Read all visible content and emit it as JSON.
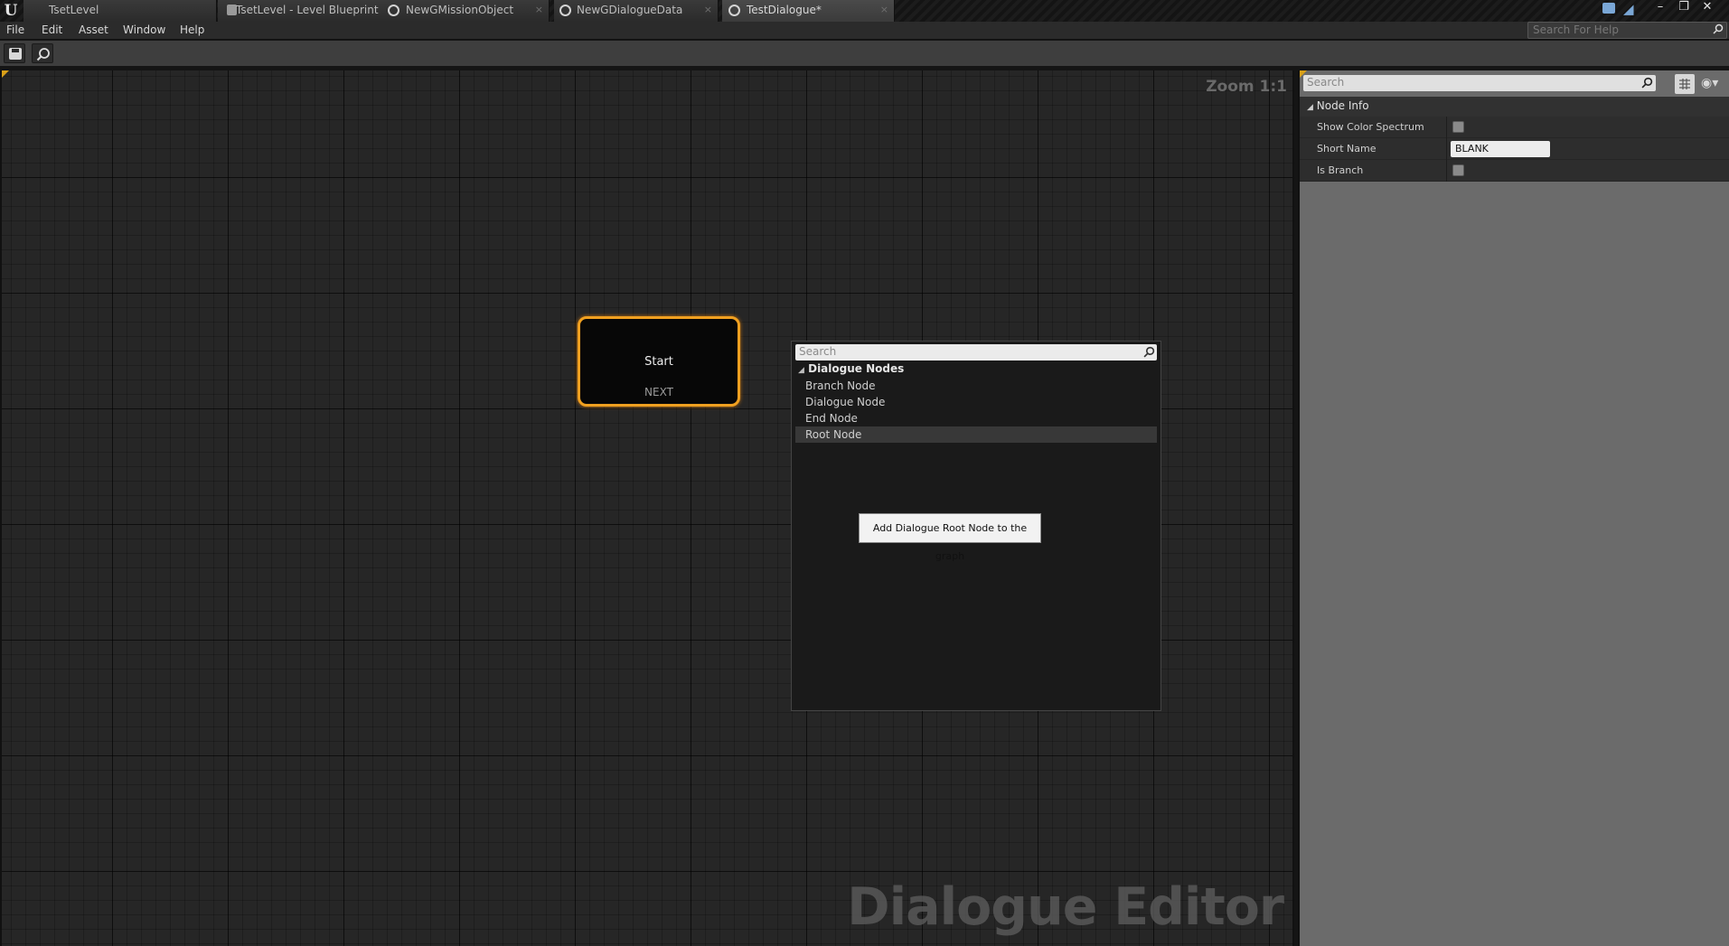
{
  "tabs": [
    {
      "label": "TsetLevel",
      "icon": "unreal-logo-icon"
    },
    {
      "label": "TsetLevel - Level Blueprint",
      "icon": "blueprint-icon",
      "close": "×"
    },
    {
      "label": "NewGMissionObject",
      "icon": "circle-icon",
      "close": "×"
    },
    {
      "label": "NewGDialogueData",
      "icon": "circle-icon",
      "close": "×"
    },
    {
      "label": "TestDialogue*",
      "icon": "circle-icon",
      "close": "×"
    }
  ],
  "app": {
    "logo": "U"
  },
  "window_controls": {
    "minimize": "–",
    "restore": "❐",
    "close": "✕"
  },
  "menu": {
    "items": [
      "File",
      "Edit",
      "Asset",
      "Window",
      "Help"
    ]
  },
  "help_search": {
    "placeholder": "Search For Help"
  },
  "graph": {
    "zoom_label": "Zoom 1:1",
    "watermark": "Dialogue Editor",
    "start_node": {
      "title": "Start",
      "pin": "NEXT",
      "border_color": "#f0a020"
    }
  },
  "context_menu": {
    "search_placeholder": "Search",
    "category": "Dialogue Nodes",
    "items": [
      "Branch Node",
      "Dialogue Node",
      "End Node",
      "Root Node"
    ],
    "hovered_index": 3,
    "tooltip": "Add Dialogue Root Node to the graph"
  },
  "details": {
    "search_placeholder": "Search",
    "section": "Node Info",
    "rows": [
      {
        "label": "Show Color Spectrum",
        "type": "checkbox",
        "checked": false
      },
      {
        "label": "Short Name",
        "type": "text",
        "value": "BLANK"
      },
      {
        "label": "Is Branch",
        "type": "checkbox",
        "checked": false
      }
    ]
  },
  "colors": {
    "accent": "#d9a018",
    "node_border": "#f0a020",
    "chat": "#7aa7d6"
  }
}
